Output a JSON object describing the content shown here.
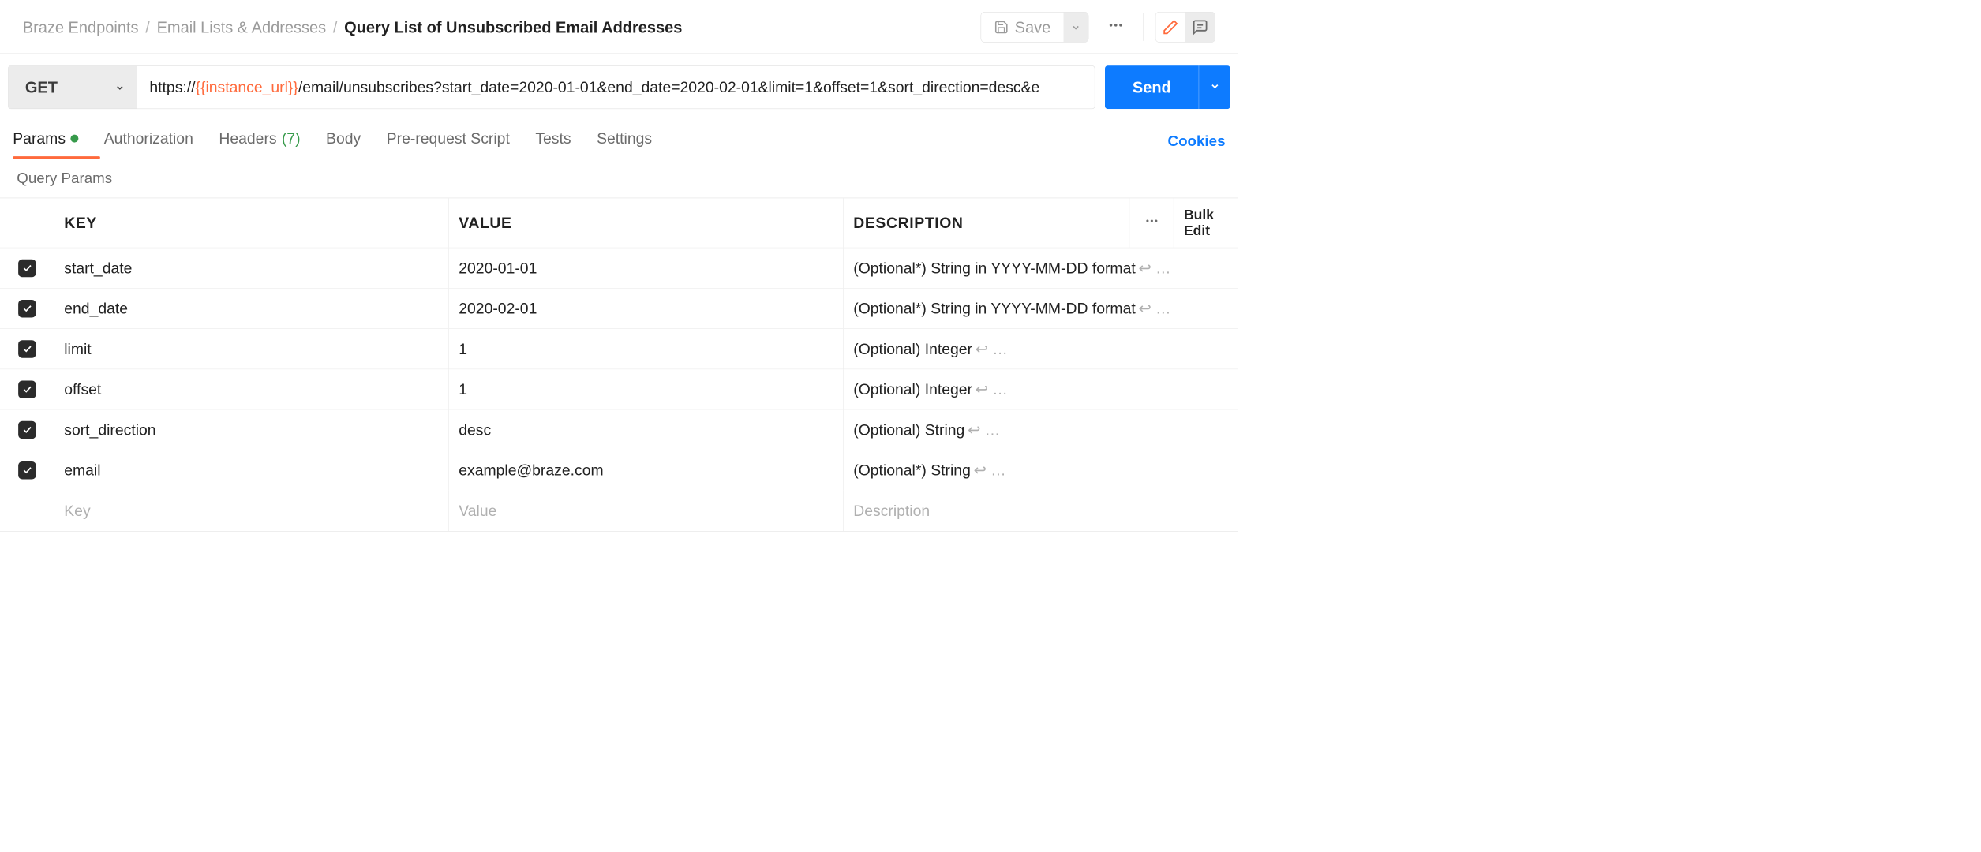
{
  "breadcrumbs": {
    "items": [
      "Braze Endpoints",
      "Email Lists & Addresses"
    ],
    "current": "Query List of Unsubscribed Email Addresses"
  },
  "toolbar": {
    "save_label": "Save"
  },
  "request": {
    "method": "GET",
    "url_prefix": "https://",
    "url_var": "{{instance_url}}",
    "url_suffix": "/email/unsubscribes?start_date=2020-01-01&end_date=2020-02-01&limit=1&offset=1&sort_direction=desc&e",
    "send_label": "Send"
  },
  "tabs": {
    "params": "Params",
    "authorization": "Authorization",
    "headers": "Headers",
    "headers_count": "(7)",
    "body": "Body",
    "prerequest": "Pre-request Script",
    "tests": "Tests",
    "settings": "Settings",
    "cookies": "Cookies"
  },
  "section_label": "Query Params",
  "columns": {
    "key": "KEY",
    "value": "VALUE",
    "description": "DESCRIPTION",
    "bulk_edit": "Bulk Edit"
  },
  "params": [
    {
      "key": "start_date",
      "value": "2020-01-01",
      "description": "(Optional*) String in YYYY-MM-DD format",
      "cont": "↩ …"
    },
    {
      "key": "end_date",
      "value": "2020-02-01",
      "description": "(Optional*)  String in YYYY-MM-DD format",
      "cont": "↩ …"
    },
    {
      "key": "limit",
      "value": "1",
      "description": "(Optional) Integer",
      "cont": "↩ …"
    },
    {
      "key": "offset",
      "value": "1",
      "description": "(Optional) Integer",
      "cont": "↩ …"
    },
    {
      "key": "sort_direction",
      "value": "desc",
      "description": "(Optional) String",
      "cont": "↩ …"
    },
    {
      "key": "email",
      "value": "example@braze.com",
      "description": "(Optional*) String",
      "cont": "↩ …"
    }
  ],
  "placeholders": {
    "key": "Key",
    "value": "Value",
    "description": "Description"
  }
}
